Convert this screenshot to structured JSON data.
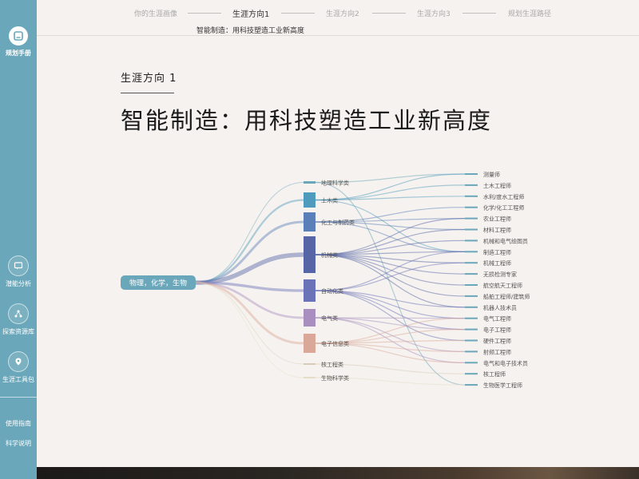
{
  "sidebar": {
    "top_item": {
      "label": "规划手册",
      "icon": "book-icon"
    },
    "items": [
      {
        "label": "潜能分析",
        "icon": "chat-icon"
      },
      {
        "label": "探索资源库",
        "icon": "network-icon"
      },
      {
        "label": "生涯工具包",
        "icon": "location-pin-icon"
      }
    ],
    "links": [
      {
        "label": "使用指南"
      },
      {
        "label": "科学说明"
      }
    ]
  },
  "nav": {
    "steps": [
      {
        "label": "你的生涯画像",
        "active": false
      },
      {
        "label": "生涯方向1",
        "active": true
      },
      {
        "label": "生涯方向2",
        "active": false
      },
      {
        "label": "生涯方向3",
        "active": false
      },
      {
        "label": "规划生涯路径",
        "active": false
      }
    ],
    "subtitle": "智能制造：用科技塑造工业新高度"
  },
  "section": {
    "eyebrow": "生涯方向 1",
    "title": "智能制造：用科技塑造工业新高度"
  },
  "sankey": {
    "source": {
      "label": "物理，化学，生物",
      "color": "#6aa7ba"
    },
    "majors": [
      {
        "label": "地理科学类",
        "color": "#6aa7ba"
      },
      {
        "label": "土木类",
        "color": "#4f9bbd"
      },
      {
        "label": "化工与制药类",
        "color": "#5b7fb8"
      },
      {
        "label": "机械类",
        "color": "#5565a6"
      },
      {
        "label": "自动化类",
        "color": "#6a72b8"
      },
      {
        "label": "电气类",
        "color": "#a88fc0"
      },
      {
        "label": "电子信息类",
        "color": "#d9a898"
      },
      {
        "label": "核工程类",
        "color": "#d8ccb8"
      },
      {
        "label": "生物科学类",
        "color": "#e6ddc8"
      }
    ],
    "jobs": [
      {
        "label": "测量师"
      },
      {
        "label": "土木工程师"
      },
      {
        "label": "水利/度水工程师"
      },
      {
        "label": "化学/化工工程师"
      },
      {
        "label": "农业工程师"
      },
      {
        "label": "材料工程师"
      },
      {
        "label": "机械和电气绘图员"
      },
      {
        "label": "制造工程师"
      },
      {
        "label": "机械工程师"
      },
      {
        "label": "无损检测专家"
      },
      {
        "label": "航空航天工程师"
      },
      {
        "label": "船舶工程师/建筑师"
      },
      {
        "label": "机器人技术员"
      },
      {
        "label": "电气工程师"
      },
      {
        "label": "电子工程师"
      },
      {
        "label": "硬件工程师"
      },
      {
        "label": "射频工程师"
      },
      {
        "label": "电气和电子技术员"
      },
      {
        "label": "核工程师"
      },
      {
        "label": "生物医学工程师"
      }
    ],
    "job_color": "#6aa7ba"
  }
}
